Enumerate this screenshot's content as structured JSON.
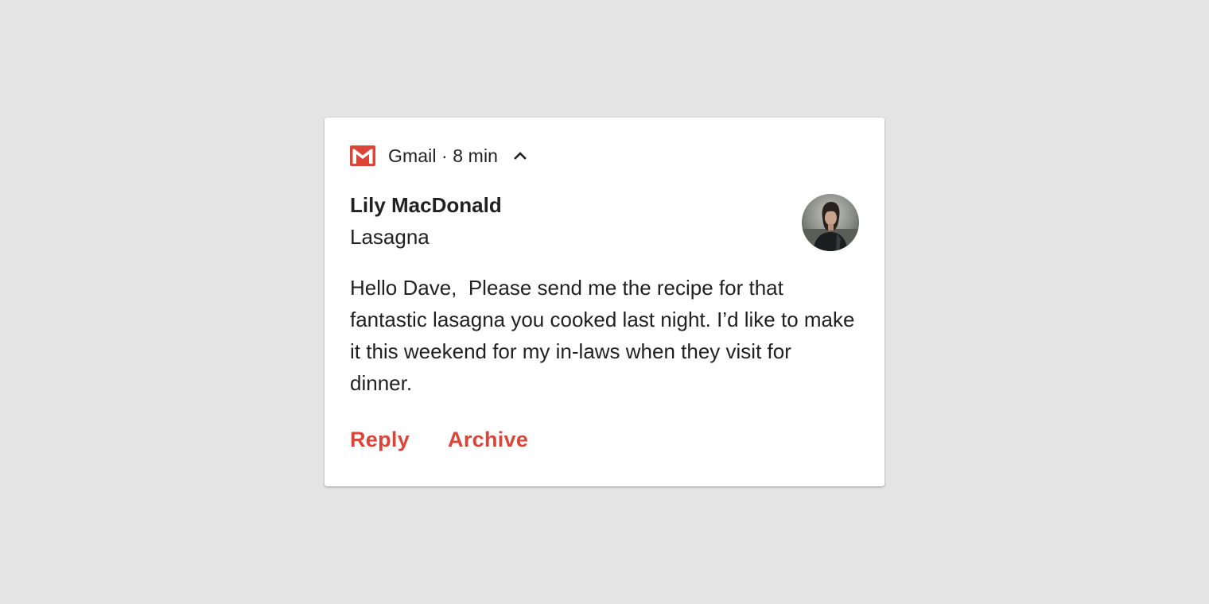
{
  "notification": {
    "app_name": "Gmail",
    "separator": " · ",
    "time": "8 min",
    "header_text": "Gmail · 8 min",
    "app_icon": "gmail-m-icon",
    "expand_icon": "chevron-up-icon",
    "sender": "Lily MacDonald",
    "subject": "Lasagna",
    "body": "Hello Dave,  Please send me the recipe for that fantastic lasagna you cooked last night. I’d like to make it this weekend for my in-laws when they visit for dinner.",
    "avatar_icon": "contact-photo-avatar",
    "actions": [
      {
        "label": "Reply"
      },
      {
        "label": "Archive"
      }
    ]
  },
  "colors": {
    "background": "#e4e4e4",
    "card": "#ffffff",
    "text_primary": "#212121",
    "accent_red": "#db4437"
  }
}
